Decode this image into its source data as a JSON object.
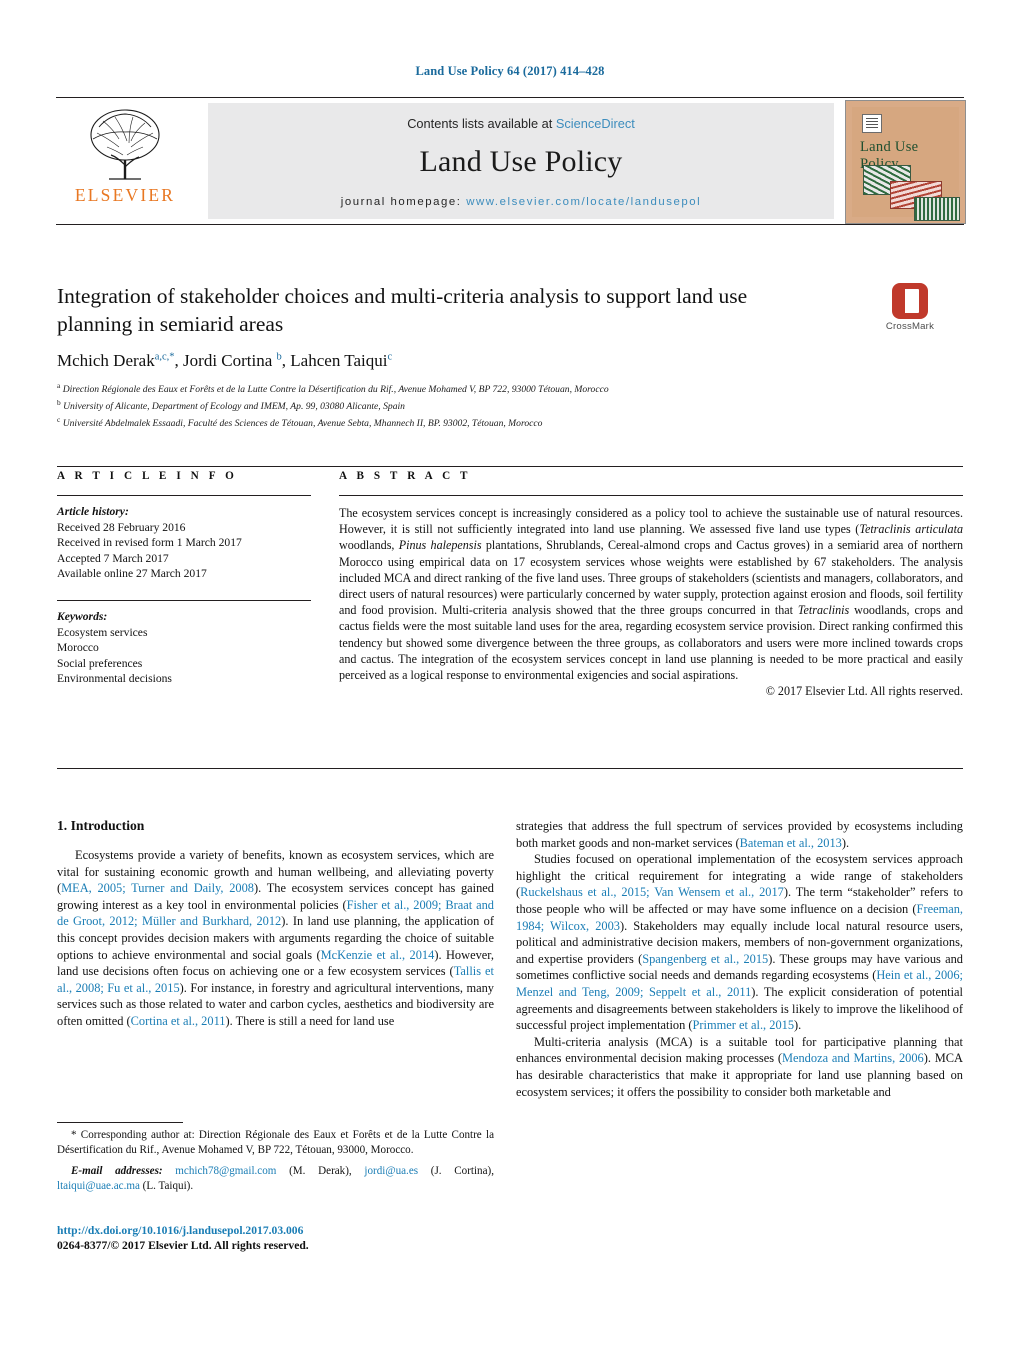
{
  "running_head": "Land Use Policy 64 (2017) 414–428",
  "masthead": {
    "contents_prefix": "Contents lists available at ",
    "contents_link": "ScienceDirect",
    "journal_name": "Land Use Policy",
    "homepage_prefix": "journal homepage: ",
    "homepage_url": "www.elsevier.com/locate/landusepol",
    "publisher": "ELSEVIER",
    "cover_title": "Land Use Policy"
  },
  "crossmark": {
    "label": "CrossMark"
  },
  "article": {
    "title": "Integration of stakeholder choices and multi-criteria analysis to support land use planning in semiarid areas",
    "authors_html": "Mchich Derak<sup>a,c,</sup><sup>*</sup>, Jordi Cortina <sup>b</sup>, Lahcen Taiqui<sup>c</sup>",
    "affiliations": [
      {
        "marker": "a",
        "text": "Direction Régionale des Eaux et Forêts et de la Lutte Contre la Désertification du Rif., Avenue Mohamed V, BP 722, 93000 Tétouan, Morocco"
      },
      {
        "marker": "b",
        "text": "University of Alicante, Department of Ecology and IMEM, Ap. 99, 03080 Alicante, Spain"
      },
      {
        "marker": "c",
        "text": "Université Abdelmalek Essaadi, Faculté des Sciences de Tétouan, Avenue Sebta, Mhannech II, BP. 93002, Tétouan, Morocco"
      }
    ]
  },
  "info": {
    "heading": "A R T I C L E  I N F O",
    "history_label": "Article history:",
    "history": [
      "Received 28 February 2016",
      "Received in revised form 1 March 2017",
      "Accepted 7 March 2017",
      "Available online 27 March 2017"
    ],
    "keywords_label": "Keywords:",
    "keywords": [
      "Ecosystem services",
      "Morocco",
      "Social preferences",
      "Environmental decisions"
    ]
  },
  "abstract": {
    "heading": "A B S T R A C T",
    "text_html": "The ecosystem services concept is increasingly considered as a policy tool to achieve the sustainable use of natural resources. However, it is still not sufficiently integrated into land use planning. We assessed five land use types (<i>Tetraclinis articulata</i> woodlands, <i>Pinus halepensis</i> plantations, Shrublands, Cereal-almond crops and Cactus groves) in a semiarid area of northern Morocco using empirical data on 17 ecosystem services whose weights were established by 67 stakeholders. The analysis included MCA and direct ranking of the five land uses. Three groups of stakeholders (scientists and managers, collaborators, and direct users of natural resources) were particularly concerned by water supply, protection against erosion and floods, soil fertility and food provision. Multi-criteria analysis showed that the three groups concurred in that <i>Tetraclinis</i> woodlands, crops and cactus fields were the most suitable land uses for the area, regarding ecosystem service provision. Direct ranking confirmed this tendency but showed some divergence between the three groups, as collaborators and users were more inclined towards crops and cactus. The integration of the ecosystem services concept in land use planning is needed to be more practical and easily perceived as a logical response to environmental exigencies and social aspirations.",
    "copyright": "© 2017 Elsevier Ltd. All rights reserved."
  },
  "introduction": {
    "heading": "1.  Introduction",
    "left_paragraphs_html": [
      "Ecosystems provide a variety of benefits, known as ecosystem services, which are vital for sustaining economic growth and human wellbeing, and alleviating poverty (<span class=\"ref\">MEA, 2005; Turner and Daily, 2008</span>). The ecosystem services concept has gained growing interest as a key tool in environmental policies (<span class=\"ref\">Fisher et al., 2009; Braat and de Groot, 2012; Müller and Burkhard, 2012</span>). In land use planning, the application of this concept provides decision makers with arguments regarding the choice of suitable options to achieve environmental and social goals (<span class=\"ref\">McKenzie et al., 2014</span>). However, land use decisions often focus on achieving one or a few ecosystem services (<span class=\"ref\">Tallis et al., 2008; Fu et al., 2015</span>). For instance, in forestry and agricultural interventions, many services such as those related to water and carbon cycles, aesthetics and biodiversity are often omitted (<span class=\"ref\">Cortina et al., 2011</span>). There is still a need for land use"
    ],
    "right_paragraphs_html": [
      "strategies that address the full spectrum of services provided by ecosystems including both market goods and non-market services (<span class=\"ref\">Bateman et al., 2013</span>).",
      "Studies focused on operational implementation of the ecosystem services approach highlight the critical requirement for integrating a wide range of stakeholders (<span class=\"ref\">Ruckelshaus et al., 2015; Van Wensem et al., 2017</span>). The term “stakeholder” refers to those people who will be affected or may have some influence on a decision (<span class=\"ref\">Freeman, 1984; Wilcox, 2003</span>). Stakeholders may equally include local natural resource users, political and administrative decision makers, members of non-government organizations, and expertise providers (<span class=\"ref\">Spangenberg et al., 2015</span>). These groups may have various and sometimes conflictive social needs and demands regarding ecosystems (<span class=\"ref\">Hein et al., 2006; Menzel and Teng, 2009; Seppelt et al., 2011</span>). The explicit consideration of potential agreements and disagreements between stakeholders is likely to improve the likelihood of successful project implementation (<span class=\"ref\">Primmer et al., 2015</span>).",
      "Multi-criteria analysis (MCA) is a suitable tool for participative planning that enhances environmental decision making processes (<span class=\"ref\">Mendoza and Martins, 2006</span>). MCA has desirable characteristics that make it appropriate for land use planning based on ecosystem services; it offers the possibility to consider both marketable and"
    ]
  },
  "footnotes": {
    "corresponding_html": "* Corresponding author at: Direction Régionale des Eaux et Forêts et de la Lutte Contre la Désertification du Rif., Avenue Mohamed V, BP 722, Tétouan, 93000, Morocco.",
    "email_label": "E-mail addresses:",
    "emails_html": "<span class=\"ref\">mchich78@gmail.com</span> (M. Derak), <span class=\"ref\">jordi@ua.es</span> (J. Cortina), <span class=\"ref\">ltaiqui@uae.ac.ma</span> (L. Taiqui)."
  },
  "footer": {
    "doi": "http://dx.doi.org/10.1016/j.landusepol.2017.03.006",
    "issn_line": "0264-8377/© 2017 Elsevier Ltd. All rights reserved."
  },
  "colors": {
    "link": "#1a7db5",
    "running_head": "#1a6a9c",
    "elsevier_orange": "#e87722",
    "crossmark_red": "#c0392b",
    "banner_gray": "#e9e9ea"
  }
}
